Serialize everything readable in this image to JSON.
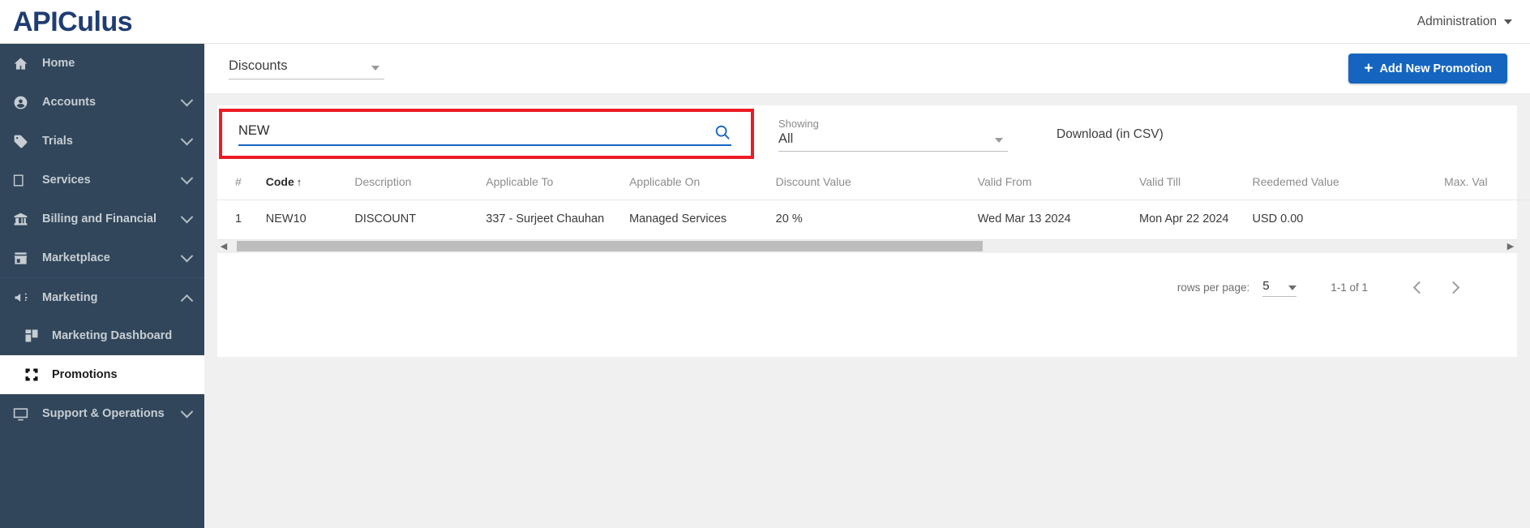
{
  "brand": {
    "name_upper": "APIC",
    "name_lower": "ulus",
    "color": "#1f3d72"
  },
  "topbar": {
    "account_label": "Administration"
  },
  "sidebar": {
    "items": [
      {
        "label": "Home",
        "icon": "home-icon",
        "expandable": false
      },
      {
        "label": "Accounts",
        "icon": "user-circle-icon",
        "expandable": true
      },
      {
        "label": "Trials",
        "icon": "tag-icon",
        "expandable": true
      },
      {
        "label": "Services",
        "icon": "layers-icon",
        "expandable": true
      },
      {
        "label": "Billing and Financial",
        "icon": "bank-icon",
        "expandable": true
      },
      {
        "label": "Marketplace",
        "icon": "store-icon",
        "expandable": true
      },
      {
        "label": "Marketing",
        "icon": "megaphone-icon",
        "expandable": true,
        "expanded": true
      },
      {
        "label": "Support & Operations",
        "icon": "monitor-icon",
        "expandable": true
      }
    ],
    "marketing_children": [
      {
        "label": "Marketing Dashboard",
        "icon": "dashboard-grid-icon",
        "active": false
      },
      {
        "label": "Promotions",
        "icon": "promotions-icon",
        "active": true
      }
    ]
  },
  "page": {
    "type_selector_value": "Discounts",
    "add_button_label": "Add New Promotion"
  },
  "search": {
    "value": "NEW",
    "placeholder": "",
    "icon": "search-icon"
  },
  "showing": {
    "label": "Showing",
    "value": "All"
  },
  "download": {
    "label": "Download (in CSV)"
  },
  "table": {
    "columns": [
      {
        "key": "num",
        "label": "#",
        "sorted": false
      },
      {
        "key": "code",
        "label": "Code",
        "sorted": true,
        "sort_dir": "↑"
      },
      {
        "key": "description",
        "label": "Description",
        "sorted": false
      },
      {
        "key": "applicable_to",
        "label": "Applicable To",
        "sorted": false
      },
      {
        "key": "applicable_on",
        "label": "Applicable On",
        "sorted": false
      },
      {
        "key": "discount_value",
        "label": "Discount Value",
        "sorted": false
      },
      {
        "key": "valid_from",
        "label": "Valid From",
        "sorted": false
      },
      {
        "key": "valid_till",
        "label": "Valid Till",
        "sorted": false
      },
      {
        "key": "redeemed_value",
        "label": "Reedemed Value",
        "sorted": false
      },
      {
        "key": "max_value",
        "label": "Max. Val",
        "sorted": false
      }
    ],
    "rows": [
      {
        "num": "1",
        "code": "NEW10",
        "description": "DISCOUNT",
        "applicable_to": "337 - Surjeet Chauhan",
        "applicable_on": "Managed Services",
        "discount_value": "20 %",
        "valid_from": "Wed Mar 13 2024",
        "valid_till": "Mon Apr 22 2024",
        "redeemed_value": "USD 0.00",
        "max_value": ""
      }
    ]
  },
  "pagination": {
    "rows_per_page_label": "rows per page:",
    "rows_per_page_value": "5",
    "range_label": "1-1 of 1",
    "prev_icon": "chevron-left-icon",
    "next_icon": "chevron-right-icon"
  },
  "scrollbar": {
    "left_icon": "◀",
    "right_icon": "▶"
  },
  "colors": {
    "sidebar_bg": "#31465a",
    "accent": "#1565c0",
    "highlight": "#ef1b24"
  }
}
